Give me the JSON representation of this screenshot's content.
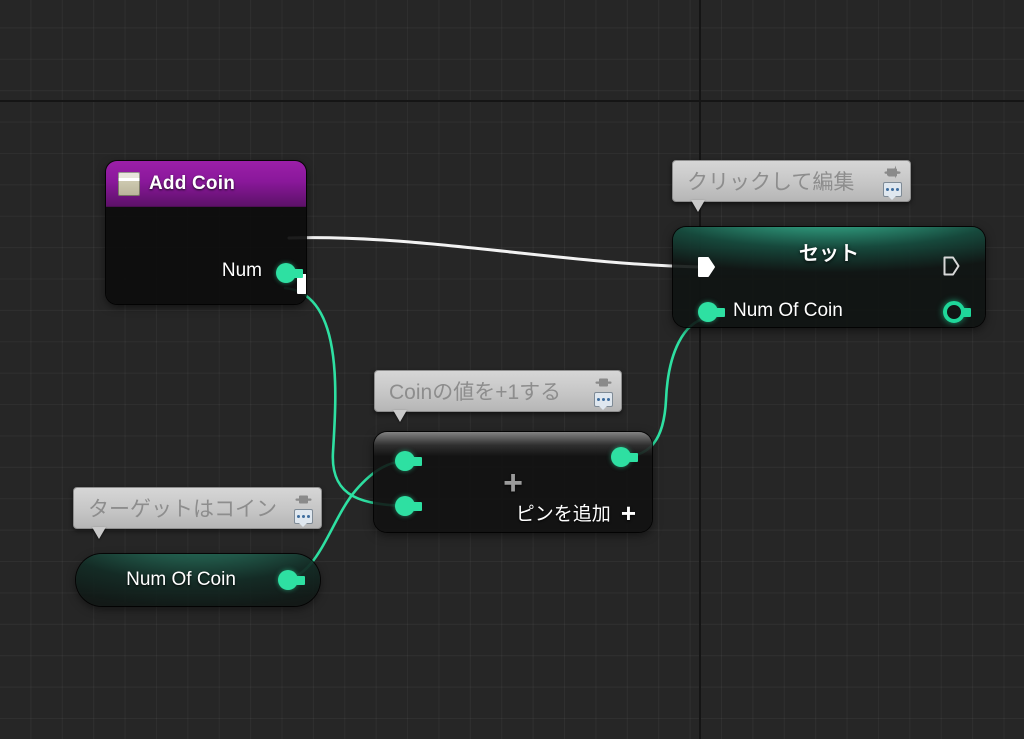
{
  "app": {
    "name": "Unreal Engine Blueprint Graph"
  },
  "canvas": {
    "background_color": "#262626",
    "grid_line_color": "#303030",
    "major_grid_color": "#151515"
  },
  "nodes": {
    "add_coin_event": {
      "title": "Add Coin",
      "icon": "function-icon",
      "header_color": "#8a189b",
      "exec_out": {
        "name": "exec-output-pin",
        "type": "exec"
      },
      "data_out": {
        "label": "Num",
        "type": "integer",
        "color": "#2ee0a2"
      }
    },
    "set_node": {
      "title": "セット",
      "header_color": "#2ee0a2",
      "exec_in": {
        "name": "exec-input-pin",
        "type": "exec"
      },
      "exec_out": {
        "name": "exec-output-pin",
        "type": "exec"
      },
      "data_in": {
        "label": "Num Of Coin",
        "type": "integer",
        "color": "#2ee0a2"
      },
      "data_out": {
        "label": "",
        "type": "integer",
        "color": "#1fd79a"
      }
    },
    "add_node": {
      "plus_symbol": "+",
      "add_pin_label": "ピンを追加",
      "add_pin_symbol": "+",
      "inputs": [
        {
          "label": "",
          "type": "integer",
          "color": "#2ee0a2"
        },
        {
          "label": "",
          "type": "integer",
          "color": "#2ee0a2"
        }
      ],
      "output": {
        "label": "",
        "type": "integer",
        "color": "#2ee0a2"
      }
    },
    "num_of_coin_getter": {
      "label": "Num Of Coin",
      "output": {
        "type": "integer",
        "color": "#2ee0a2"
      }
    }
  },
  "comments": [
    {
      "id": "set-comment",
      "text": "クリックして編集",
      "pin_icon": "pushpin-icon",
      "chat_icon": "comment-bubble-icon"
    },
    {
      "id": "add-comment",
      "text": "Coinの値を+1する",
      "pin_icon": "pushpin-icon",
      "chat_icon": "comment-bubble-icon"
    },
    {
      "id": "getter-comment",
      "text": "ターゲットはコイン",
      "pin_icon": "pushpin-icon",
      "chat_icon": "comment-bubble-icon"
    }
  ],
  "wires": [
    {
      "name": "exec-wire-addcoin-to-set",
      "color": "#ffffff",
      "type": "exec"
    },
    {
      "name": "data-wire-num-to-add-input-2",
      "color": "#2ee0a2",
      "type": "data"
    },
    {
      "name": "data-wire-getter-to-add-input-1",
      "color": "#2ee0a2",
      "type": "data"
    },
    {
      "name": "data-wire-add-output-to-set",
      "color": "#2ee0a2",
      "type": "data"
    }
  ]
}
